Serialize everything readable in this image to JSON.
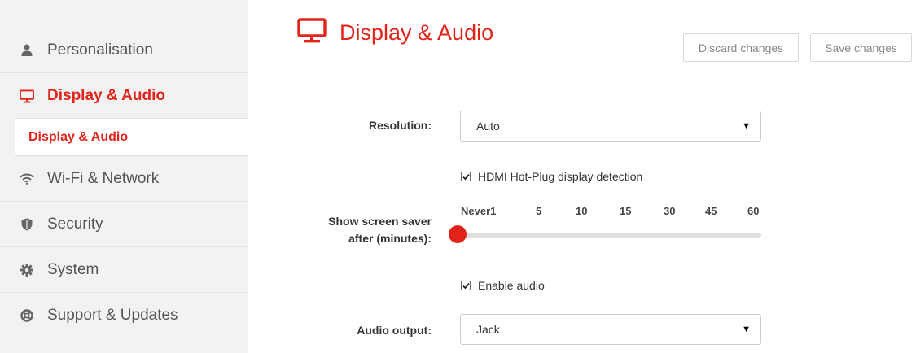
{
  "sidebar": {
    "items": [
      {
        "label": "Personalisation",
        "icon": "person-icon",
        "active": false
      },
      {
        "label": "Display & Audio",
        "icon": "monitor-icon",
        "active": true
      },
      {
        "label": "Wi-Fi & Network",
        "icon": "wifi-icon",
        "active": false
      },
      {
        "label": "Security",
        "icon": "shield-icon",
        "active": false
      },
      {
        "label": "System",
        "icon": "gear-icon",
        "active": false
      },
      {
        "label": "Support & Updates",
        "icon": "lifebuoy-icon",
        "active": false
      }
    ],
    "sub_item": {
      "label": "Display & Audio"
    }
  },
  "header": {
    "title": "Display & Audio",
    "icon": "monitor-icon",
    "discard_label": "Discard changes",
    "save_label": "Save changes"
  },
  "form": {
    "resolution": {
      "label": "Resolution:",
      "value": "Auto"
    },
    "hdmi": {
      "label": "HDMI Hot-Plug display detection",
      "checked": true
    },
    "screensaver": {
      "label_line1": "Show screen saver",
      "label_line2": "after (minutes):",
      "ticks": [
        "Never1",
        "5",
        "10",
        "15",
        "30",
        "45",
        "60"
      ],
      "selected": "Never1",
      "position_fraction": 0
    },
    "audio_enable": {
      "label": "Enable audio",
      "checked": true
    },
    "audio_output": {
      "label": "Audio output:",
      "value": "Jack"
    }
  },
  "colors": {
    "accent": "#e2231a",
    "sidebar_bg": "#f2f2f2",
    "text": "#333333",
    "muted_text": "#555555"
  }
}
